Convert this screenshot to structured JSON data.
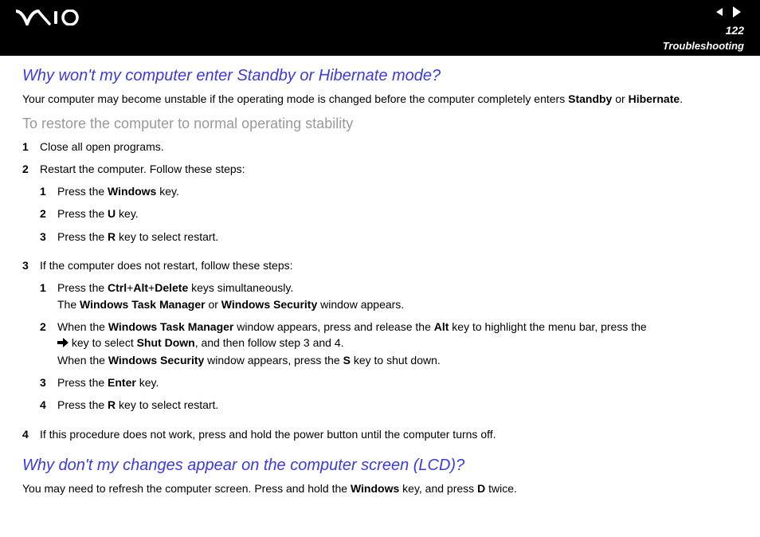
{
  "header": {
    "page_number": "122",
    "section": "Troubleshooting"
  },
  "q1": {
    "title": "Why won't my computer enter Standby or Hibernate mode?",
    "intro_pre": "Your computer may become unstable if the operating mode is changed before the computer completely enters ",
    "intro_b1": "Standby",
    "intro_mid": " or ",
    "intro_b2": "Hibernate",
    "intro_post": ".",
    "subheading": "To restore the computer to normal operating stability",
    "step1": "Close all open programs.",
    "step2": "Restart the computer. Follow these steps:",
    "s2_1_pre": "Press the ",
    "s2_1_b": "Windows",
    "s2_1_post": " key.",
    "s2_2_pre": "Press the ",
    "s2_2_b": "U",
    "s2_2_post": " key.",
    "s2_3_pre": "Press the ",
    "s2_3_b": "R",
    "s2_3_post": " key to select restart.",
    "step3": "If the computer does not restart, follow these steps:",
    "s3_1_pre": "Press the ",
    "s3_1_b1": "Ctrl",
    "s3_1_mid1": "+",
    "s3_1_b2": "Alt",
    "s3_1_mid2": "+",
    "s3_1_b3": "Delete",
    "s3_1_post": " keys simultaneously.",
    "s3_1_line2_pre": "The ",
    "s3_1_line2_b1": "Windows Task Manager",
    "s3_1_line2_mid": " or ",
    "s3_1_line2_b2": "Windows Security",
    "s3_1_line2_post": " window appears.",
    "s3_2_pre": "When the ",
    "s3_2_b1": "Windows Task Manager",
    "s3_2_mid1": " window appears, press and release the ",
    "s3_2_b2": "Alt",
    "s3_2_mid2": " key to highlight the menu bar, press the ",
    "s3_2_mid3": " key to select ",
    "s3_2_b3": "Shut Down",
    "s3_2_post": ", and then follow step 3 and 4.",
    "s3_2_line2_pre": "When the ",
    "s3_2_line2_b1": "Windows Security",
    "s3_2_line2_mid": " window appears, press the ",
    "s3_2_line2_b2": "S",
    "s3_2_line2_post": " key to shut down.",
    "s3_3_pre": "Press the ",
    "s3_3_b": "Enter",
    "s3_3_post": " key.",
    "s3_4_pre": "Press the ",
    "s3_4_b": "R",
    "s3_4_post": " key to select restart.",
    "step4": "If this procedure does not work, press and hold the power button until the computer turns off."
  },
  "q2": {
    "title": "Why don't my changes appear on the computer screen (LCD)?",
    "body_pre": "You may need to refresh the computer screen. Press and hold the ",
    "body_b1": "Windows",
    "body_mid": " key, and press ",
    "body_b2": "D",
    "body_post": " twice."
  },
  "nums": {
    "n1": "1",
    "n2": "2",
    "n3": "3",
    "n4": "4"
  }
}
